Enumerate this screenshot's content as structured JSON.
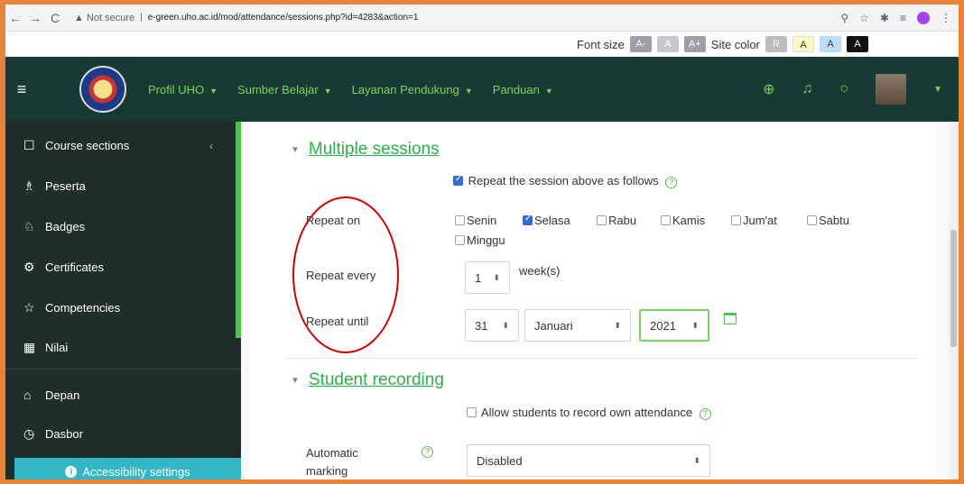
{
  "browser": {
    "back": "←",
    "forward": "→",
    "reload": "C",
    "security": "▲ Not secure",
    "url": "e-green.uho.ac.id/mod/attendance/sessions.php?id=4283&action=1"
  },
  "a11y": {
    "font_size_label": "Font size",
    "font_dec": "A-",
    "font_norm": "A",
    "font_inc": "A+",
    "site_color_label": "Site color",
    "color_r": "R",
    "color_a1": "A",
    "color_a2": "A",
    "color_a3": "A"
  },
  "navbar": {
    "menu": [
      "Profil UHO",
      "Sumber Belajar",
      "Layanan Pendukung",
      "Panduan"
    ]
  },
  "sidebar": {
    "items": [
      {
        "icon": "☐",
        "label": "Course sections"
      },
      {
        "icon": "♗",
        "label": "Peserta"
      },
      {
        "icon": "♘",
        "label": "Badges"
      },
      {
        "icon": "⚙",
        "label": "Certificates"
      },
      {
        "icon": "☆",
        "label": "Competencies"
      },
      {
        "icon": "▦",
        "label": "Nilai"
      },
      {
        "icon": "⌂",
        "label": "Depan"
      },
      {
        "icon": "◷",
        "label": "Dasbor"
      }
    ],
    "accessibility": "Accessibility settings"
  },
  "multiple_sessions": {
    "title": "Multiple sessions",
    "repeat_checkbox": "Repeat the session above as follows",
    "repeat_on_label": "Repeat on",
    "days": [
      {
        "label": "Senin",
        "checked": false
      },
      {
        "label": "Selasa",
        "checked": true
      },
      {
        "label": "Rabu",
        "checked": false
      },
      {
        "label": "Kamis",
        "checked": false
      },
      {
        "label": "Jum'at",
        "checked": false
      },
      {
        "label": "Sabtu",
        "checked": false
      },
      {
        "label": "Minggu",
        "checked": false
      }
    ],
    "repeat_every_label": "Repeat every",
    "repeat_every_value": "1",
    "repeat_every_unit": "week(s)",
    "repeat_until_label": "Repeat until",
    "until_day": "31",
    "until_month": "Januari",
    "until_year": "2021"
  },
  "student_recording": {
    "title": "Student recording",
    "allow_checkbox": "Allow students to record own attendance",
    "automatic_label_1": "Automatic",
    "automatic_label_2": "marking",
    "automatic_value": "Disabled"
  },
  "colors": {
    "frame": "#e8843a",
    "navbar": "#173a34",
    "sidebar": "#1f2e2a",
    "accent_green": "#2bb04a",
    "annotation_red": "#d40000"
  }
}
